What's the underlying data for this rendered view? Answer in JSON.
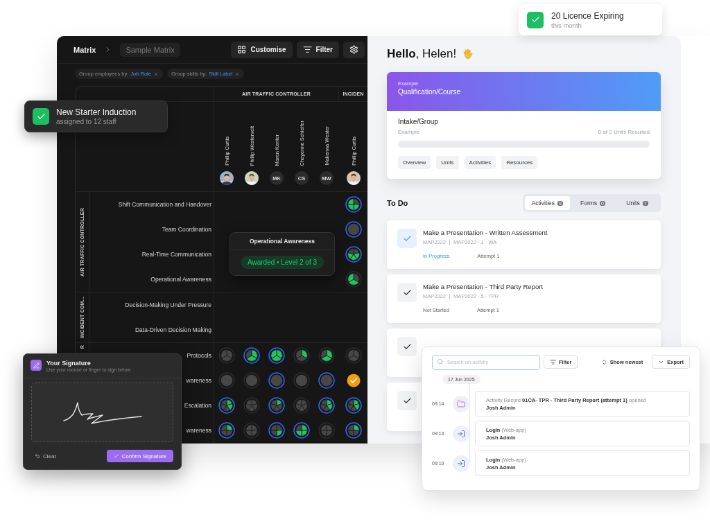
{
  "matrix": {
    "breadcrumb": {
      "root": "Matrix",
      "current": "Sample Matrix"
    },
    "toolbar": [
      {
        "kind": "customise",
        "label": "Customise"
      },
      {
        "kind": "filter",
        "label": "Filter"
      },
      {
        "kind": "settings"
      }
    ],
    "chips": [
      {
        "label": "Group employees by:",
        "value": "Job Role"
      },
      {
        "label": "Group skills by:",
        "value": "Skill Label"
      }
    ],
    "column_groups": [
      {
        "label": "AIR TRAFFIC CONTROLLER",
        "people": [
          {
            "name": "Phillip Curtis"
          },
          {
            "name": "Phillip Westervelt"
          },
          {
            "name": "Maren Kenter",
            "kind": "initials",
            "initials": "MK"
          },
          {
            "name": "Cheyenne Schleifer",
            "kind": "initials",
            "initials": "CS"
          },
          {
            "name": "Makenna Wester",
            "kind": "initials",
            "initials": "MW"
          }
        ]
      },
      {
        "label": "INCIDEN",
        "people": [
          {
            "name": "Phillip Curtis"
          }
        ]
      }
    ],
    "row_groups": [
      {
        "label": "AIR TRAFFIC CONTROLLER",
        "rows": [
          {
            "skill": "Shift Communication and Handover",
            "cells": [
              {
                "kind": "empty"
              },
              {
                "kind": "empty"
              },
              {
                "kind": "empty"
              },
              {
                "kind": "empty"
              },
              {
                "kind": "empty"
              },
              {
                "kind": "pie",
                "segments": [
                  false,
                  true,
                  true,
                  true
                ],
                "outlined": true
              }
            ]
          },
          {
            "skill": "Team Coordination",
            "cells": [
              {
                "kind": "empty"
              },
              {
                "kind": "empty"
              },
              {
                "kind": "empty"
              },
              {
                "kind": "empty"
              },
              {
                "kind": "empty"
              },
              {
                "kind": "pie",
                "segments": [
                  false
                ],
                "outlined": true
              }
            ]
          },
          {
            "skill": "Real-Time Communication",
            "cells": [
              {
                "kind": "empty"
              },
              {
                "kind": "empty"
              },
              {
                "kind": "empty"
              },
              {
                "kind": "empty"
              },
              {
                "kind": "empty"
              },
              {
                "kind": "pie",
                "segments": [
                  false,
                  true,
                  true,
                  true,
                  false
                ],
                "outlined": true
              }
            ]
          },
          {
            "skill": "Operational Awareness",
            "cells": [
              {
                "kind": "empty"
              },
              {
                "kind": "empty"
              },
              {
                "kind": "empty"
              },
              {
                "kind": "empty"
              },
              {
                "kind": "empty"
              },
              {
                "kind": "pie",
                "segments": [
                  false,
                  true,
                  true
                ],
                "outlined": false
              }
            ]
          }
        ]
      },
      {
        "label": "INCIDENT COM...",
        "rows": [
          {
            "skill": "Decision-Making Under Pressure",
            "cells": []
          },
          {
            "skill": "Data-Driven Decision Making",
            "cells": []
          }
        ]
      },
      {
        "label": "R",
        "rows": [
          {
            "skill": "Protocols",
            "cells": [
              {
                "kind": "pie",
                "segments": [
                  false,
                  false,
                  false
                ],
                "outlined": false
              },
              {
                "kind": "pie",
                "segments": [
                  true,
                  true,
                  false
                ],
                "outlined": true
              },
              {
                "kind": "pie",
                "segments": [
                  true,
                  true,
                  true
                ],
                "outlined": true
              },
              {
                "kind": "pie",
                "segments": [
                  true,
                  false,
                  false
                ],
                "outlined": false
              },
              {
                "kind": "pie",
                "segments": [
                  true,
                  true,
                  false
                ],
                "outlined": false
              },
              {
                "kind": "pie",
                "segments": [
                  false,
                  false,
                  false
                ],
                "outlined": false
              }
            ]
          },
          {
            "skill": "wareness",
            "cells": [
              {
                "kind": "pie",
                "segments": [
                  false
                ],
                "outlined": false
              },
              {
                "kind": "pie",
                "segments": [
                  false
                ],
                "outlined": false
              },
              {
                "kind": "pie",
                "segments": [
                  false
                ],
                "outlined": true
              },
              {
                "kind": "pie",
                "segments": [
                  false
                ],
                "outlined": false
              },
              {
                "kind": "pie",
                "segments": [
                  false
                ],
                "outlined": true
              },
              {
                "kind": "done"
              }
            ]
          },
          {
            "skill": "Escalation",
            "cells": [
              {
                "kind": "pie",
                "segments": [
                  true,
                  true,
                  false,
                  false,
                  false
                ],
                "outlined": true
              },
              {
                "kind": "pie",
                "segments": [
                  false,
                  false,
                  false,
                  false,
                  false
                ],
                "outlined": false
              },
              {
                "kind": "pie",
                "segments": [
                  true,
                  false,
                  false,
                  false,
                  false
                ],
                "outlined": true
              },
              {
                "kind": "pie",
                "segments": [
                  false,
                  false,
                  false,
                  false,
                  false
                ],
                "outlined": false
              },
              {
                "kind": "pie",
                "segments": [
                  true,
                  true,
                  false,
                  false,
                  false
                ],
                "outlined": true
              },
              {
                "kind": "pie",
                "segments": [
                  true,
                  true,
                  false,
                  false,
                  false
                ],
                "outlined": true
              }
            ]
          },
          {
            "skill": "wareness",
            "cells": [
              {
                "kind": "pie",
                "segments": [
                  true,
                  false,
                  false,
                  false
                ],
                "outlined": true
              },
              {
                "kind": "pie",
                "segments": [
                  false,
                  false,
                  false,
                  false
                ],
                "outlined": false
              },
              {
                "kind": "pie",
                "segments": [
                  false,
                  true,
                  false,
                  false
                ],
                "outlined": true
              },
              {
                "kind": "pie",
                "segments": [
                  true,
                  true,
                  true,
                  false
                ],
                "outlined": true
              },
              {
                "kind": "pie",
                "segments": [
                  false,
                  false,
                  false,
                  false
                ],
                "outlined": false
              },
              {
                "kind": "pie",
                "segments": [
                  true,
                  false,
                  false,
                  false
                ],
                "outlined": true
              }
            ]
          }
        ]
      }
    ],
    "tooltip": {
      "title": "Operational Awareness",
      "badge": "Awarded • Level 2 of 3"
    }
  },
  "licence_card": {
    "title": "20 Licence Expiring",
    "subtitle": "this month"
  },
  "induction_card": {
    "title": "New Starter Induction",
    "subtitle": "assigned to 12 staff"
  },
  "dashboard": {
    "greeting": "**Hello**, Helen!",
    "course": {
      "eyebrow": "Example",
      "title": "Qualification/Course",
      "group_title": "Intake/Group",
      "group_name": "Example",
      "progress_text": "0 of 2 Units Resulted",
      "level": 0,
      "tabs": [
        "Overview",
        "Units",
        "Activities",
        "Resources"
      ]
    },
    "todo": {
      "title": "To Do",
      "tabs": [
        {
          "label": "Activities",
          "count": "9",
          "selected": true
        },
        {
          "label": "Forms",
          "count": "0",
          "selected": false
        },
        {
          "label": "Units",
          "count": "7",
          "selected": false
        }
      ],
      "items": [
        {
          "kind": "active",
          "title": "Make a Presentation - Written Assessment",
          "code": "MAP2022",
          "ref": "MAP2022 - 1 - WA",
          "status": "In Progress",
          "attempt": "Attempt 1"
        },
        {
          "kind": "pending",
          "title": "Make a Presentation - Third Party Report",
          "code": "MAP2022",
          "ref": "MAP2022 - 5 - TPR",
          "status": "Not Started",
          "attempt": "Attempt 1"
        },
        {
          "kind": "pending"
        },
        {
          "kind": "pending"
        }
      ]
    }
  },
  "activity_log": {
    "search": {
      "placeholder": "Search an activity"
    },
    "filter": "Filter",
    "sort": "Show newest",
    "export": "Export",
    "date": "17 Jun 2025",
    "entries": [
      {
        "time": "09:14",
        "kind": "folder",
        "text": "Activity Record **01CA- TPR - Third Party Report (attempt 1)** opened",
        "user": "Josh Admin"
      },
      {
        "time": "09:13",
        "kind": "login",
        "text": "**Login** (Web-app)",
        "user": "Josh Admin"
      },
      {
        "time": "09:10",
        "kind": "login",
        "text": "**Login** (Web-app)",
        "user": "Josh Admin"
      }
    ]
  },
  "signature": {
    "title": "Your Signature",
    "hint": "Use your mouse or finger to sign below",
    "clear": "Clear",
    "confirm": "Confirm Signature"
  }
}
